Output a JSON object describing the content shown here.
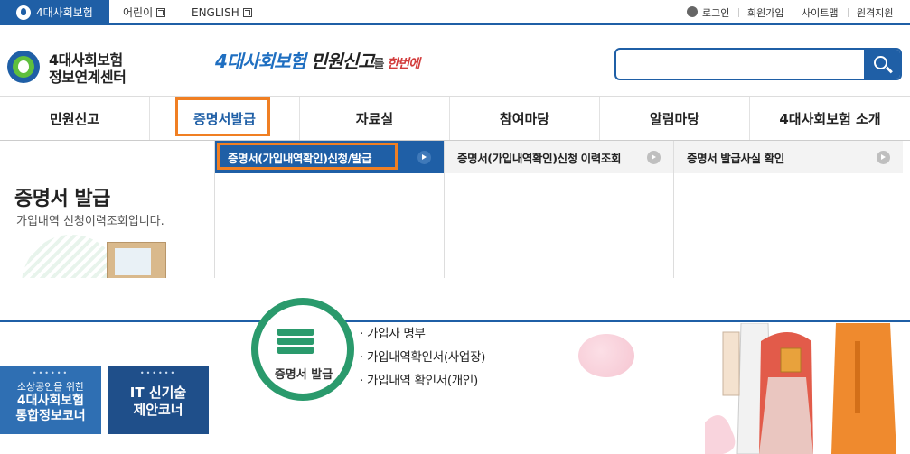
{
  "topbar": {
    "main_tab": "4대사회보험",
    "kids": "어린이",
    "english": "ENGLISH",
    "login": "로그인",
    "signup": "회원가입",
    "sitemap": "사이트맵",
    "remote": "원격지원"
  },
  "header": {
    "logo_line1": "4대사회보험",
    "logo_line2": "정보연계센터",
    "slogan_a": "4대사회보험",
    "slogan_b": " 민원신고",
    "slogan_c": "를",
    "slogan_d": " 한번에",
    "search_value": ""
  },
  "gnb": {
    "items": [
      "민원신고",
      "증명서발급",
      "자료실",
      "참여마당",
      "알림마당",
      "4대사회보험 소개"
    ],
    "active_index": 1
  },
  "dropdown": {
    "title": "증명서 발급",
    "desc": "가입내역 신청이력조회입니다.",
    "columns": [
      "증명서(가입내역확인)신청/발급",
      "증명서(가입내역확인)신청 이력조회",
      "증명서 발급사실 확인"
    ]
  },
  "content": {
    "cert_label": "증명서 발급",
    "items": [
      "· 가입자 명부",
      "· 가입내역확인서(사업장)",
      "· 가입내역 확인서(개인)"
    ]
  },
  "side_buttons": {
    "b1_small": "소상공인을 위한",
    "b1_line1": "4대사회보험",
    "b1_line2": "통합정보코너",
    "b2_line1": "IT 신기술",
    "b2_line2": "제안코너"
  },
  "colors": {
    "brand_blue": "#1f5fa6",
    "highlight_orange": "#f07f23",
    "cert_green": "#2a9a6c"
  }
}
